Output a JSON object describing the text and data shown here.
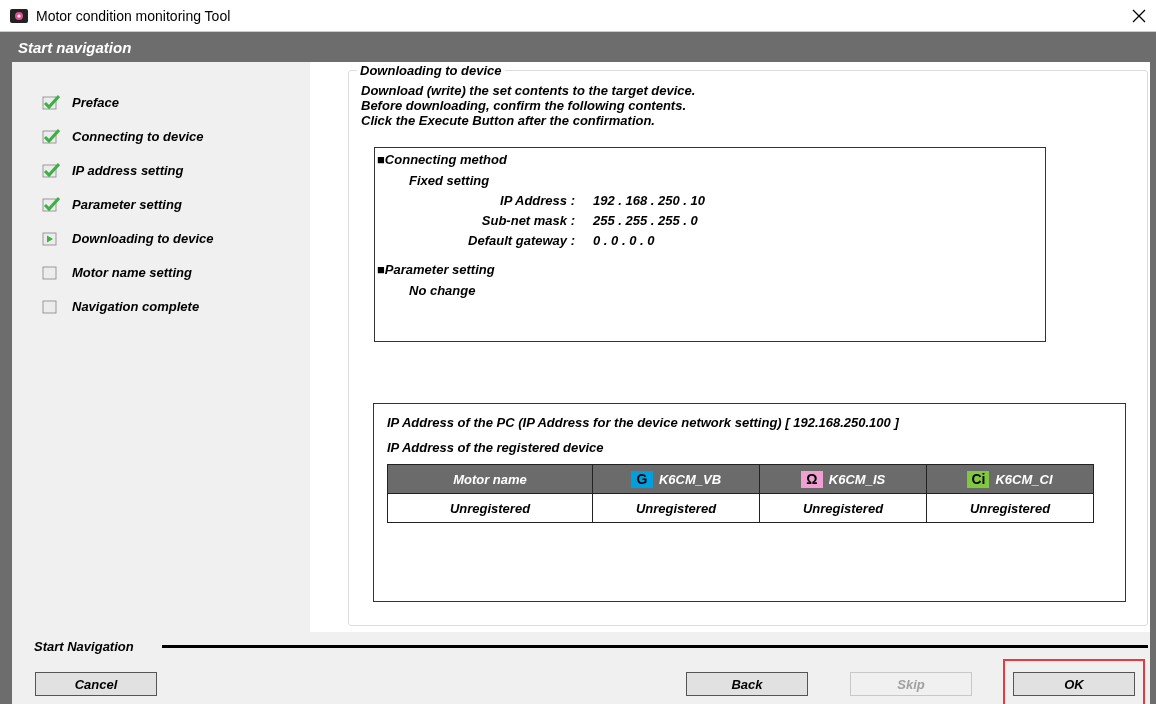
{
  "window": {
    "title": "Motor condition monitoring Tool"
  },
  "header": {
    "title": "Start navigation"
  },
  "steps": [
    {
      "label": "Preface",
      "checked": true,
      "current": false
    },
    {
      "label": "Connecting to device",
      "checked": true,
      "current": false
    },
    {
      "label": "IP address setting",
      "checked": true,
      "current": false
    },
    {
      "label": "Parameter setting",
      "checked": true,
      "current": false
    },
    {
      "label": "Downloading to device",
      "checked": false,
      "current": true
    },
    {
      "label": "Motor name setting",
      "checked": false,
      "current": false
    },
    {
      "label": "Navigation complete",
      "checked": false,
      "current": false
    }
  ],
  "panel": {
    "title": "Downloading to device",
    "intro": [
      "Download (write) the set contents to the target device.",
      "Before downloading, confirm the following contents.",
      "Click the Execute Button after the confirmation."
    ],
    "summary": {
      "sections": [
        {
          "bullet": "■",
          "heading": "Connecting method",
          "subheading": "Fixed setting",
          "fields": [
            {
              "label": "IP Address :",
              "value": "192 . 168 . 250 . 10"
            },
            {
              "label": "Sub-net mask :",
              "value": "255 . 255 . 255 . 0"
            },
            {
              "label": "Default gateway :",
              "value": "0 . 0 . 0 . 0"
            }
          ]
        },
        {
          "bullet": "■",
          "heading": "Parameter setting",
          "subheading": "No change"
        }
      ]
    },
    "registry": {
      "pc_address": "IP Address of the PC (IP Address for the device network setting)  [ 192.168.250.100 ]",
      "caption": "IP Address of the registered device",
      "columns": [
        {
          "label": "Motor name"
        },
        {
          "label": "K6CM_VB",
          "icon_text": "G",
          "color": "#00a0e0"
        },
        {
          "label": "K6CM_IS",
          "icon_text": "Ω",
          "color": "#f0a0d0"
        },
        {
          "label": "K6CM_CI",
          "icon_text": "Ci",
          "color": "#80c840"
        }
      ],
      "rows": [
        [
          "Unregistered",
          "Unregistered",
          "Unregistered",
          "Unregistered"
        ]
      ]
    }
  },
  "footer": {
    "label": "Start Navigation",
    "buttons": [
      {
        "label": "Cancel",
        "disabled": false,
        "highlighted": false
      },
      {
        "label": "Back",
        "disabled": false,
        "highlighted": false
      },
      {
        "label": "Skip",
        "disabled": true,
        "highlighted": false
      },
      {
        "label": "OK",
        "disabled": false,
        "highlighted": true
      }
    ]
  }
}
